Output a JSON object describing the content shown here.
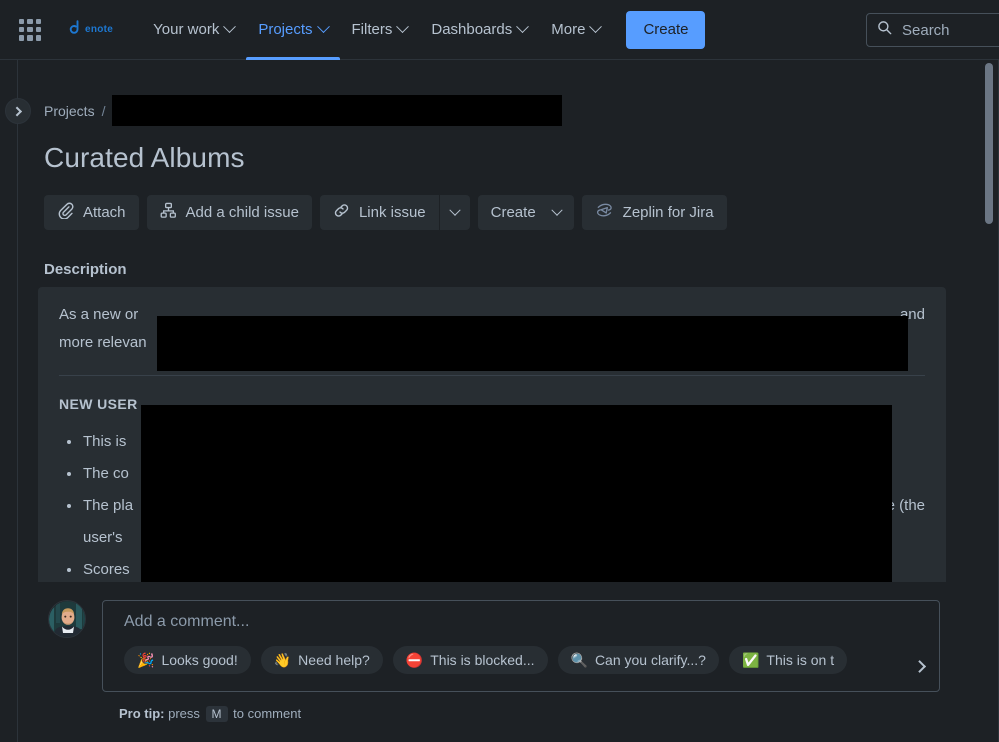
{
  "topnav": {
    "app_switcher_icon": "grid-apps-icon",
    "brand": {
      "wordmark": "enote",
      "icon": "enote-logo-icon"
    },
    "links": [
      {
        "label": "Your work",
        "has_caret": true,
        "active": false
      },
      {
        "label": "Projects",
        "has_caret": true,
        "active": true
      },
      {
        "label": "Filters",
        "has_caret": true,
        "active": false
      },
      {
        "label": "Dashboards",
        "has_caret": true,
        "active": false
      },
      {
        "label": "More",
        "has_caret": true,
        "active": false
      }
    ],
    "create_label": "Create",
    "search": {
      "placeholder": "Search",
      "value": "",
      "icon": "search-icon"
    }
  },
  "sidebar": {
    "expand_icon": "chevron-right-icon"
  },
  "breadcrumb": {
    "project_label": "Projects",
    "separator": "/",
    "redacted": true
  },
  "page": {
    "title": "Curated Albums"
  },
  "actions": [
    {
      "label": "Attach",
      "icon": "paperclip-icon"
    },
    {
      "label": "Add a child issue",
      "icon": "child-issue-icon"
    },
    {
      "label": "Link issue",
      "icon": "link-chain-icon",
      "has_dropdown": true
    },
    {
      "label": "Create",
      "icon": "",
      "has_dropdown": true
    },
    {
      "label": "Zeplin for Jira",
      "icon": "zeplin-icon"
    }
  ],
  "description": {
    "label": "Description",
    "paragraph_start": "As a new or",
    "paragraph_mid": "and",
    "paragraph_second_line": "more relevan",
    "section_heading": "NEW USER",
    "bullets": [
      {
        "visible_start": "This is",
        "visible_end": ""
      },
      {
        "visible_start": "The co",
        "visible_end": ""
      },
      {
        "visible_start": "The pla",
        "visible_end": "e (the"
      },
      {
        "visible_start": "user's",
        "visible_end": ""
      },
      {
        "visible_start": "Scores",
        "visible_end": ""
      }
    ]
  },
  "comment": {
    "avatar_name": "user-avatar",
    "placeholder": "Add a comment...",
    "chips": [
      {
        "emoji": "🎉",
        "label": "Looks good!"
      },
      {
        "emoji": "👋",
        "label": "Need help?"
      },
      {
        "emoji": "⛔",
        "label": "This is blocked..."
      },
      {
        "emoji": "🔍",
        "label": "Can you clarify...?"
      },
      {
        "emoji": "✅",
        "label": "This is on t"
      }
    ],
    "scroll_icon": "chevron-right-icon",
    "protip_prefix": "Pro tip:",
    "protip_text_before": "press",
    "protip_key": "M",
    "protip_text_after": "to comment"
  },
  "colors": {
    "page_bg": "#1D2125",
    "panel_bg": "#282E33",
    "accent": "#579DFF",
    "text": "#B6C2CF",
    "muted_text": "#9FADBC",
    "border": "#46505A",
    "redaction": "#000000"
  }
}
